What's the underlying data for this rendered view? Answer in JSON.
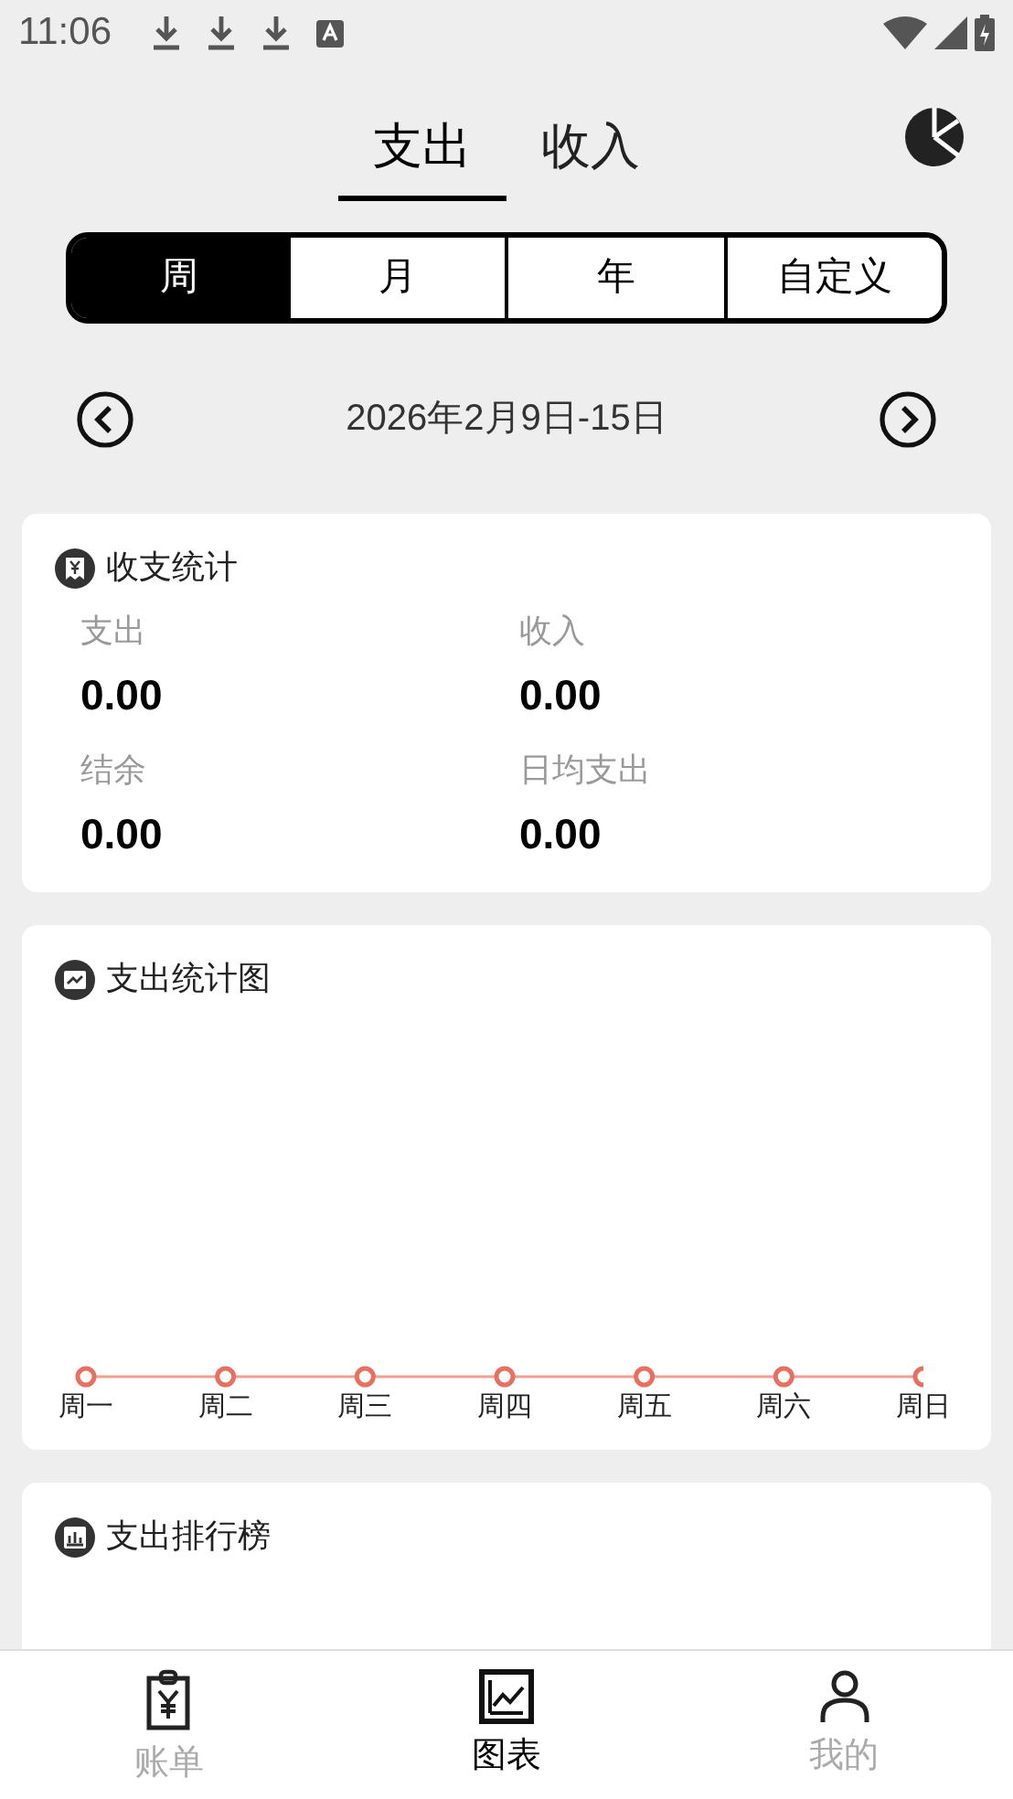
{
  "status_bar": {
    "time": "11:06"
  },
  "type_tabs": [
    {
      "label": "支出",
      "selected": true
    },
    {
      "label": "收入",
      "selected": false
    }
  ],
  "period_tabs": [
    {
      "label": "周",
      "selected": true
    },
    {
      "label": "月",
      "selected": false
    },
    {
      "label": "年",
      "selected": false
    },
    {
      "label": "自定义",
      "selected": false
    }
  ],
  "date_range": "2026年2月9日-15日",
  "summary": {
    "title": "收支统计",
    "items": [
      {
        "label": "支出",
        "value": "0.00"
      },
      {
        "label": "收入",
        "value": "0.00"
      },
      {
        "label": "结余",
        "value": "0.00"
      },
      {
        "label": "日均支出",
        "value": "0.00"
      }
    ]
  },
  "expense_chart": {
    "title": "支出统计图",
    "x_labels": [
      "周一",
      "周二",
      "周三",
      "周四",
      "周五",
      "周六",
      "周日"
    ]
  },
  "ranking": {
    "title": "支出排行榜"
  },
  "bottom_nav": [
    {
      "label": "账单",
      "selected": false,
      "kind": "bill"
    },
    {
      "label": "图表",
      "selected": true,
      "kind": "chart"
    },
    {
      "label": "我的",
      "selected": false,
      "kind": "user"
    }
  ]
}
